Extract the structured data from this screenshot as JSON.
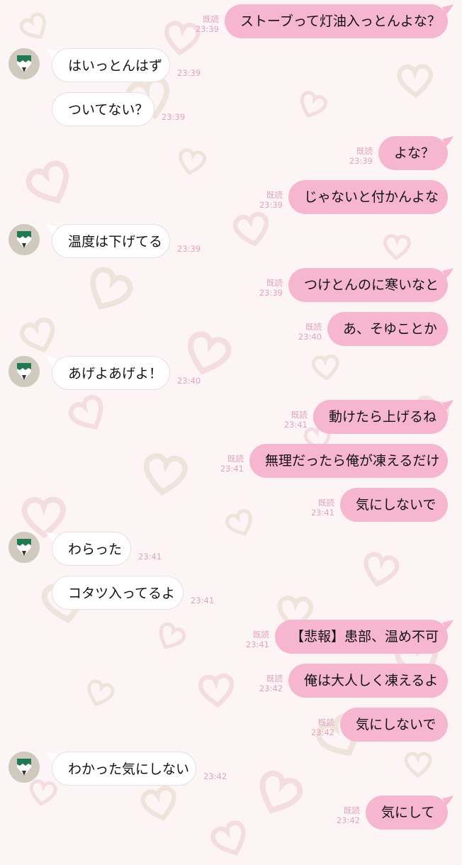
{
  "chat": {
    "read_label": "既読",
    "messages": [
      {
        "dir": "out",
        "text": "ストーブって灯油入っとんよな？",
        "time": "23:39",
        "read": true
      },
      {
        "dir": "in",
        "text": "はいっとんはず",
        "time": "23:39",
        "avatar": true
      },
      {
        "dir": "in",
        "text": "ついてない？",
        "time": "23:39",
        "avatar": false
      },
      {
        "dir": "out",
        "text": "よな？",
        "time": "23:39",
        "read": true
      },
      {
        "dir": "out",
        "text": "じゃないと付かんよな",
        "time": "23:39",
        "read": true
      },
      {
        "dir": "in",
        "text": "温度は下げてる",
        "time": "23:39",
        "avatar": true
      },
      {
        "dir": "out",
        "text": "つけとんのに寒いなと",
        "time": "23:39",
        "read": true
      },
      {
        "dir": "out",
        "text": "あ、そゆことか",
        "time": "23:40",
        "read": true
      },
      {
        "dir": "in",
        "text": "あげよあげよ！",
        "time": "23:40",
        "avatar": true
      },
      {
        "dir": "out",
        "text": "動けたら上げるね",
        "time": "23:41",
        "read": true
      },
      {
        "dir": "out",
        "text": "無理だったら俺が凍えるだけ",
        "time": "23:41",
        "read": true
      },
      {
        "dir": "out",
        "text": "気にしないで",
        "time": "23:41",
        "read": true
      },
      {
        "dir": "in",
        "text": "わらった",
        "time": "23:41",
        "avatar": true
      },
      {
        "dir": "in",
        "text": "コタツ入ってるよ",
        "time": "23:41",
        "avatar": false
      },
      {
        "dir": "out",
        "text": "【悲報】患部、温め不可",
        "time": "23:41",
        "read": true
      },
      {
        "dir": "out",
        "text": "俺は大人しく凍えるよ",
        "time": "23:42",
        "read": true
      },
      {
        "dir": "out",
        "text": "気にしないで",
        "time": "23:42",
        "read": true
      },
      {
        "dir": "in",
        "text": "わかった気にしない",
        "time": "23:42",
        "avatar": true
      },
      {
        "dir": "out",
        "text": "気にして",
        "time": "23:42",
        "read": true
      }
    ]
  },
  "colors": {
    "background": "#fdf4f6",
    "outgoing_bubble": "#f6b6cf",
    "incoming_bubble": "#ffffff",
    "meta_text": "#e3a3bd",
    "avatar_green": "#1f7a52"
  },
  "icons": {
    "avatar": "green-pencil-avatar-icon",
    "background": "heart-pattern"
  }
}
